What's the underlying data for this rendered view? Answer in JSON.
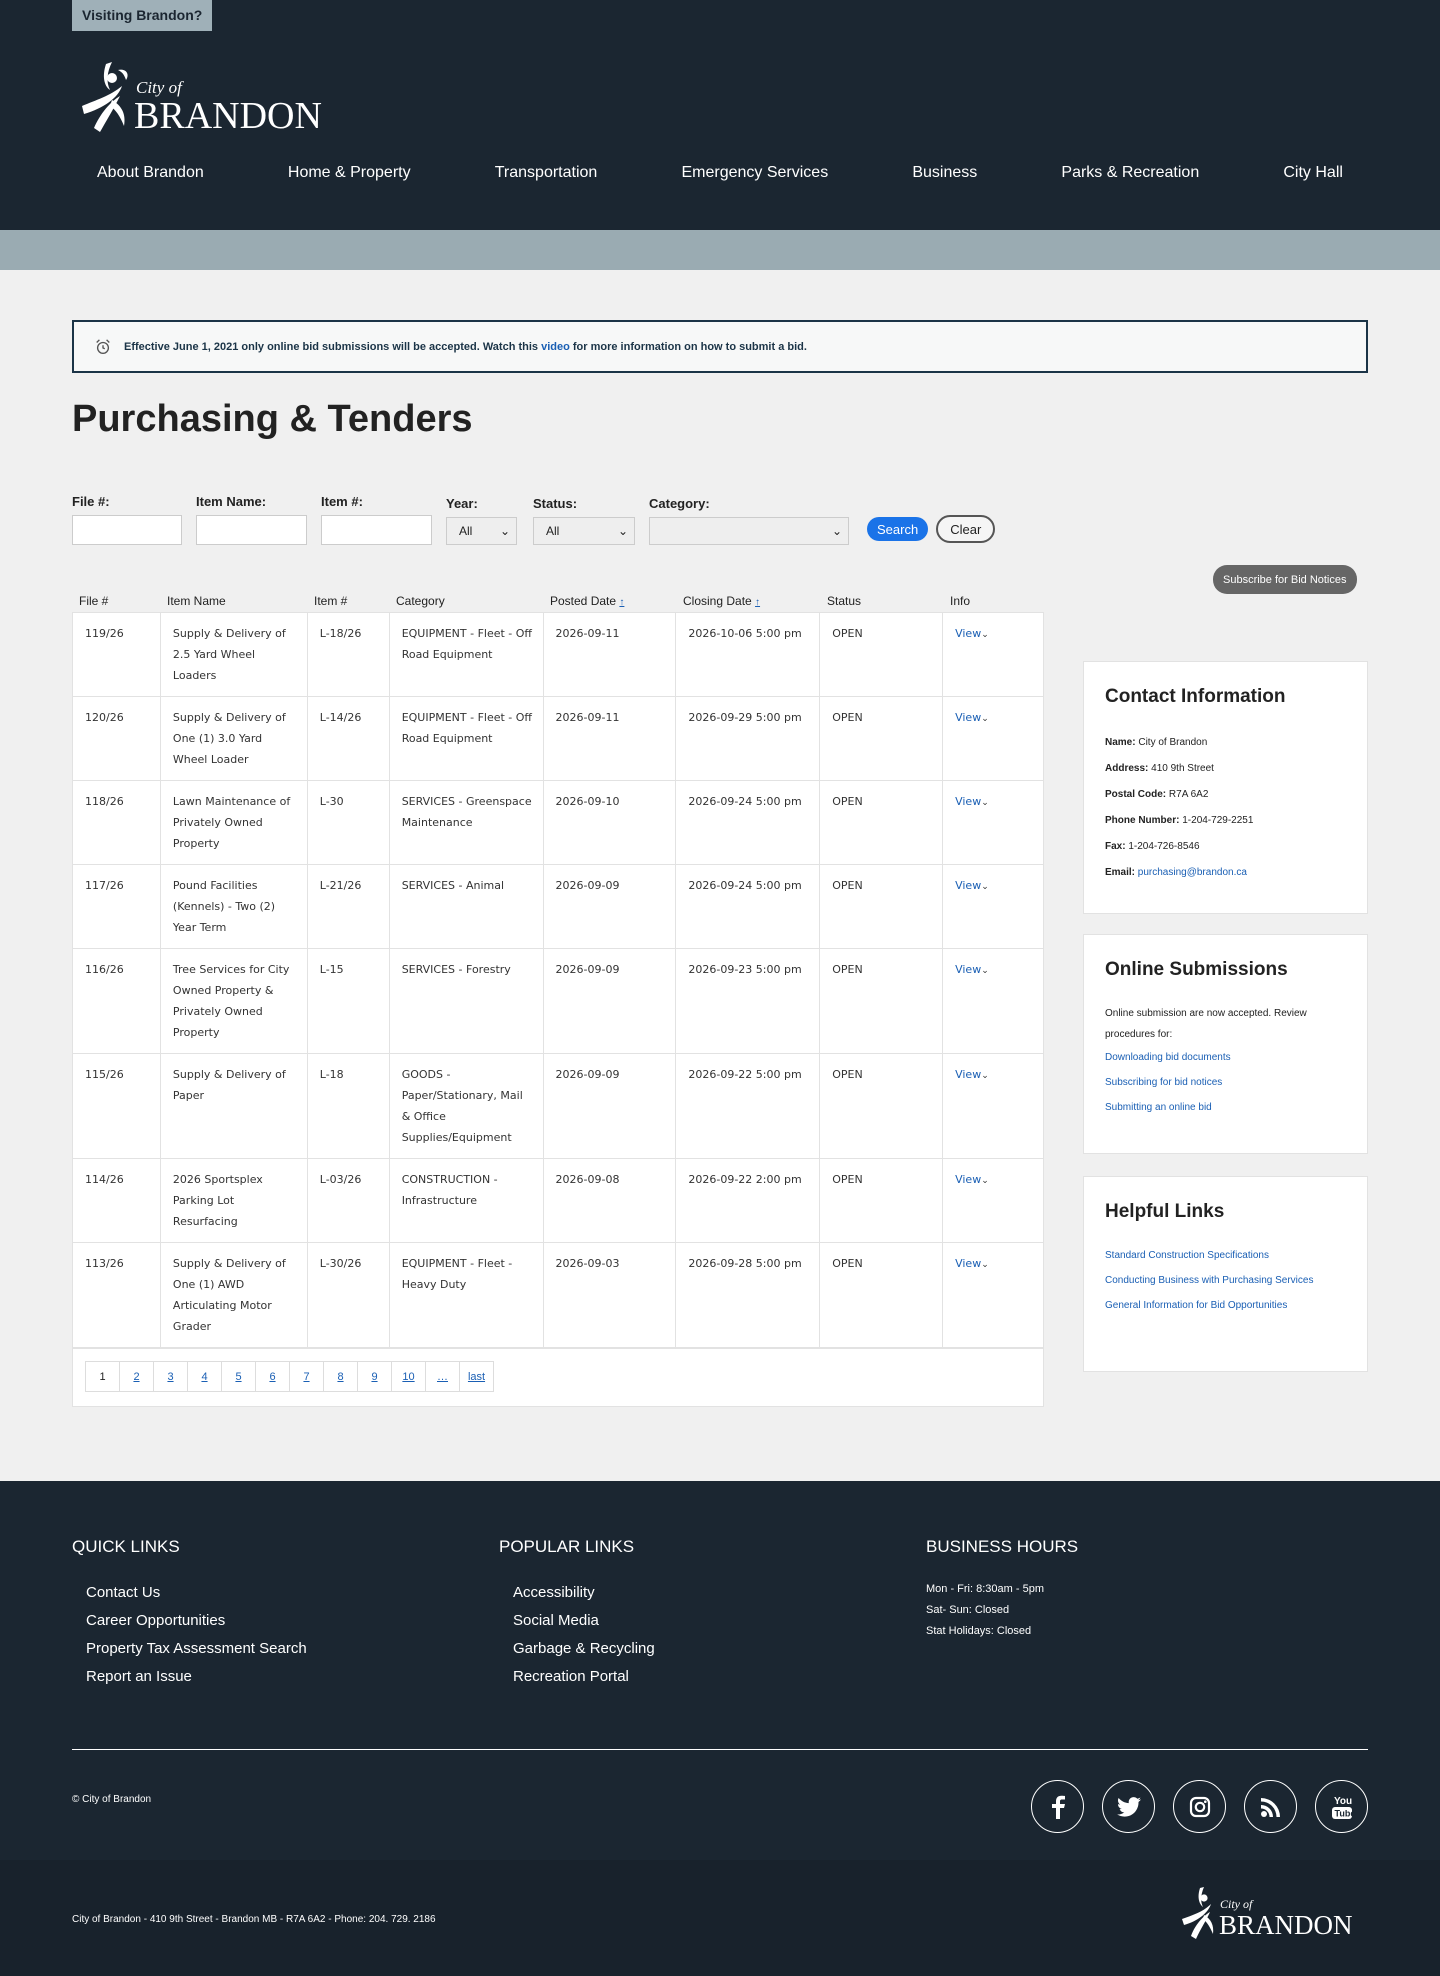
{
  "header": {
    "visiting": "Visiting Brandon?",
    "logo_city_of": "City of",
    "logo_name": "BRANDON",
    "nav": [
      "About Brandon",
      "Home & Property",
      "Transportation",
      "Emergency Services",
      "Business",
      "Parks & Recreation",
      "City Hall"
    ]
  },
  "notice": {
    "text_before": "Effective June 1, 2021 only online bid submissions will be accepted. Watch this ",
    "link": "video",
    "text_after": " for more information on how to submit a bid."
  },
  "page_title": "Purchasing & Tenders",
  "filters": {
    "file_label": "File #:",
    "item_name_label": "Item Name:",
    "item_no_label": "Item #:",
    "year_label": "Year:",
    "year_value": "All",
    "status_label": "Status:",
    "status_value": "All",
    "category_label": "Category:",
    "search_label": "Search",
    "clear_label": "Clear"
  },
  "subscribe_label": "Subscribe for Bid Notices",
  "table": {
    "headers": [
      "File #",
      "Item Name",
      "Item #",
      "Category",
      "Posted Date",
      "Closing Date",
      "Status",
      "Info"
    ],
    "sort_arrow": "↑",
    "view_label": "View",
    "rows": [
      {
        "file": "119/26",
        "name": "Supply & Delivery of 2.5 Yard Wheel Loaders",
        "item": "L-18/26",
        "category": "EQUIPMENT - Fleet - Off Road Equipment",
        "posted": "2026-09-11",
        "closing": "2026-10-06 5:00 pm",
        "status": "OPEN"
      },
      {
        "file": "120/26",
        "name": "Supply & Delivery of One (1) 3.0 Yard Wheel Loader",
        "item": "L-14/26",
        "category": "EQUIPMENT - Fleet - Off Road Equipment",
        "posted": "2026-09-11",
        "closing": "2026-09-29 5:00 pm",
        "status": "OPEN"
      },
      {
        "file": "118/26",
        "name": "Lawn Maintenance of Privately Owned Property",
        "item": "L-30",
        "category": "SERVICES - Greenspace Maintenance",
        "posted": "2026-09-10",
        "closing": "2026-09-24 5:00 pm",
        "status": "OPEN"
      },
      {
        "file": "117/26",
        "name": "Pound Facilities (Kennels) - Two (2) Year Term",
        "item": "L-21/26",
        "category": "SERVICES - Animal",
        "posted": "2026-09-09",
        "closing": "2026-09-24 5:00 pm",
        "status": "OPEN"
      },
      {
        "file": "116/26",
        "name": "Tree Services for City Owned Property & Privately Owned Property",
        "item": "L-15",
        "category": "SERVICES - Forestry",
        "posted": "2026-09-09",
        "closing": "2026-09-23 5:00 pm",
        "status": "OPEN"
      },
      {
        "file": "115/26",
        "name": "Supply & Delivery of Paper",
        "item": "L-18",
        "category": "GOODS - Paper/Stationary, Mail & Office Supplies/Equipment",
        "posted": "2026-09-09",
        "closing": "2026-09-22 5:00 pm",
        "status": "OPEN"
      },
      {
        "file": "114/26",
        "name": "2026 Sportsplex Parking Lot Resurfacing",
        "item": "L-03/26",
        "category": "CONSTRUCTION - Infrastructure",
        "posted": "2026-09-08",
        "closing": "2026-09-22 2:00 pm",
        "status": "OPEN"
      },
      {
        "file": "113/26",
        "name": "Supply & Delivery of One (1) AWD Articulating Motor Grader",
        "item": "L-30/26",
        "category": "EQUIPMENT - Fleet - Heavy Duty",
        "posted": "2026-09-03",
        "closing": "2026-09-28 5:00 pm",
        "status": "OPEN"
      }
    ],
    "pages": [
      "1",
      "2",
      "3",
      "4",
      "5",
      "6",
      "7",
      "8",
      "9",
      "10",
      "…",
      "last"
    ]
  },
  "contact": {
    "title": "Contact Information",
    "name_label": "Name:",
    "name": "City of Brandon",
    "address_label": "Address:",
    "address": "410 9th Street",
    "postal_label": "Postal Code:",
    "postal": "R7A 6A2",
    "phone_label": "Phone Number:",
    "phone": "1-204-729-2251",
    "fax_label": "Fax:",
    "fax": "1-204-726-8546",
    "email_label": "Email:",
    "email": "purchasing@brandon.ca"
  },
  "online": {
    "title": "Online Submissions",
    "text": "Online submission are now accepted. Review procedures for:",
    "links": [
      "Downloading bid documents",
      "Subscribing for bid notices",
      "Submitting an online bid"
    ]
  },
  "helpful": {
    "title": "Helpful Links",
    "links": [
      "Standard Construction Specifications",
      "Conducting Business with Purchasing Services",
      "General Information for Bid Opportunities"
    ]
  },
  "footer": {
    "quick_title": "QUICK LINKS",
    "quick_links": [
      "Contact Us",
      "Career Opportunities",
      "Property Tax Assessment Search",
      "Report an Issue"
    ],
    "popular_title": "POPULAR LINKS",
    "popular_links": [
      "Accessibility",
      "Social Media",
      "Garbage & Recycling",
      "Recreation Portal"
    ],
    "hours_title": "BUSINESS HOURS",
    "hours": [
      "Mon - Fri: 8:30am - 5pm",
      "Sat- Sun: Closed",
      "Stat Holidays: Closed"
    ],
    "copyright_symbol": "©",
    "copyright_link": "City of Brandon",
    "address": "City of Brandon - 410 9th Street - Brandon MB - R7A 6A2 - Phone: 204. 729. 2186",
    "social_icons": [
      "facebook-icon",
      "twitter-icon",
      "instagram-icon",
      "rss-icon",
      "youtube-icon"
    ]
  }
}
